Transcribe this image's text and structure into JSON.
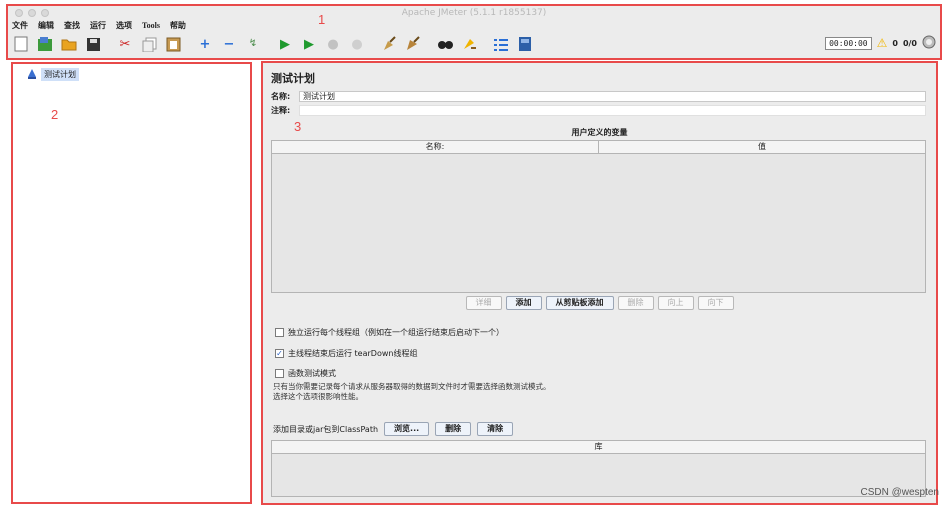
{
  "window": {
    "title": "Apache JMeter (5.1.1 r1855137)"
  },
  "annotations": {
    "region1": "1",
    "region2": "2",
    "region3": "3"
  },
  "menu": [
    "文件",
    "编辑",
    "查找",
    "运行",
    "选项",
    "Tools",
    "帮助"
  ],
  "toolbar": {
    "icons": [
      "new-icon",
      "templates-icon",
      "open-icon",
      "save-icon",
      "cut-icon",
      "copy-icon",
      "paste-icon",
      "expand-icon",
      "collapse-icon",
      "toggle-icon",
      "start-icon",
      "start-no-pause-icon",
      "stop-icon",
      "shutdown-icon",
      "clear-icon",
      "clear-all-icon",
      "search-icon",
      "reset-search-icon",
      "function-helper-icon",
      "help-icon"
    ],
    "timer": "00:00:00",
    "warning_count": "0",
    "threads": "0/0"
  },
  "tree": {
    "root_label": "测试计划"
  },
  "test_plan": {
    "title": "测试计划",
    "name_label": "名称:",
    "name_value": "测试计划",
    "comment_label": "注释:",
    "comment_value": "",
    "udv_title": "用户定义的变量",
    "udv_columns": [
      "名称:",
      "值"
    ],
    "buttons": {
      "detail": "详细",
      "add": "添加",
      "add_clipboard": "从剪贴板添加",
      "delete": "删除",
      "up": "向上",
      "down": "向下"
    },
    "options": [
      {
        "label": "独立运行每个线程组（例如在一个组运行结束后启动下一个）",
        "checked": false
      },
      {
        "label": "主线程结束后运行 tearDown线程组",
        "checked": true
      },
      {
        "label": "函数测试模式",
        "checked": false
      }
    ],
    "note_line1": "只有当你需要记录每个请求从服务器取得的数据到文件时才需要选择函数测试模式。",
    "note_line2": "选择这个选项很影响性能。",
    "classpath_label": "添加目录或jar包到ClassPath",
    "classpath_buttons": {
      "browse": "浏览...",
      "delete": "删除",
      "clear": "清除"
    },
    "lib_column": "库"
  },
  "watermark": "CSDN @wespten"
}
